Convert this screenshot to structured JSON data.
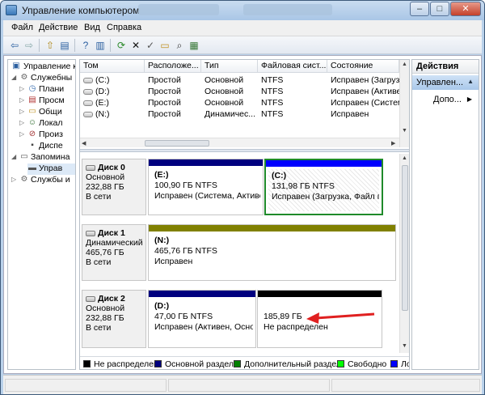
{
  "window": {
    "title": "Управление компьютером",
    "buttons": {
      "minimize": "–",
      "maximize": "□",
      "close": "✕"
    }
  },
  "menu": {
    "items": [
      "Файл",
      "Действие",
      "Вид",
      "Справка"
    ]
  },
  "toolbar": {
    "icons": [
      "back-icon",
      "forward-icon",
      "up-icon",
      "show-tree-icon",
      "help-icon",
      "refresh-icon",
      "delete-icon",
      "properties-icon",
      "open-icon",
      "search-icon",
      "export-icon"
    ]
  },
  "tree": {
    "items": [
      {
        "label": "Управление к",
        "icon": "computer-icon"
      },
      {
        "label": "Служебны",
        "icon": "tools-icon"
      },
      {
        "label": "Плани",
        "icon": "clock-icon"
      },
      {
        "label": "Просм",
        "icon": "viewer-icon"
      },
      {
        "label": "Общи",
        "icon": "share-icon"
      },
      {
        "label": "Локал",
        "icon": "users-icon"
      },
      {
        "label": "Произ",
        "icon": "perf-icon"
      },
      {
        "label": "Диспе",
        "icon": "device-icon"
      },
      {
        "label": "Запомина",
        "icon": "storage-icon"
      },
      {
        "label": "Управ",
        "icon": "disk-icon"
      },
      {
        "label": "Службы и",
        "icon": "services-icon"
      }
    ]
  },
  "volumes": {
    "columns": [
      "Том",
      "Расположе...",
      "Тип",
      "Файловая сист...",
      "Состояние"
    ],
    "rows": [
      [
        "(C:)",
        "Простой",
        "Основной",
        "NTFS",
        "Исправен (Загрузка,"
      ],
      [
        "(D:)",
        "Простой",
        "Основной",
        "NTFS",
        "Исправен (Активен, Ос"
      ],
      [
        "(E:)",
        "Простой",
        "Основной",
        "NTFS",
        "Исправен (Система, Ак"
      ],
      [
        "(N:)",
        "Простой",
        "Динамичес...",
        "NTFS",
        "Исправен"
      ]
    ]
  },
  "disks": [
    {
      "name": "Диск 0",
      "type": "Основной",
      "size": "232,88 ГБ",
      "status": "В сети",
      "partitions": [
        {
          "label": "(E:)",
          "size": "100,90 ГБ NTFS",
          "status": "Исправен (Система, Активен",
          "color": "#00007f"
        },
        {
          "label": "(C:)",
          "size": "131,98 ГБ NTFS",
          "status": "Исправен (Загрузка, Файл п",
          "color": "#0000ff"
        }
      ]
    },
    {
      "name": "Диск 1",
      "type": "Динамический",
      "size": "465,76 ГБ",
      "status": "В сети",
      "partitions": [
        {
          "label": "(N:)",
          "size": "465,76 ГБ NTFS",
          "status": "Исправен",
          "color": "#808000"
        }
      ]
    },
    {
      "name": "Диск 2",
      "type": "Основной",
      "size": "232,88 ГБ",
      "status": "В сети",
      "partitions": [
        {
          "label": "(D:)",
          "size": "47,00 ГБ NTFS",
          "status": "Исправен (Активен, Основ",
          "color": "#00007f"
        },
        {
          "size": "185,89 ГБ",
          "status": "Не распределен",
          "color": "#000000"
        }
      ]
    }
  ],
  "legend": [
    {
      "label": "Не распределен",
      "color": "#000000"
    },
    {
      "label": "Основной раздел",
      "color": "#00007f"
    },
    {
      "label": "Дополнительный раздел",
      "color": "#008000"
    },
    {
      "label": "Свободно",
      "color": "#00ff00"
    },
    {
      "label": "Ло",
      "color": "#0000ff"
    }
  ],
  "actions": {
    "header": "Действия",
    "section": "Управлен...",
    "item": "Допо..."
  },
  "annotation": {
    "arrow_color": "#e02020"
  }
}
